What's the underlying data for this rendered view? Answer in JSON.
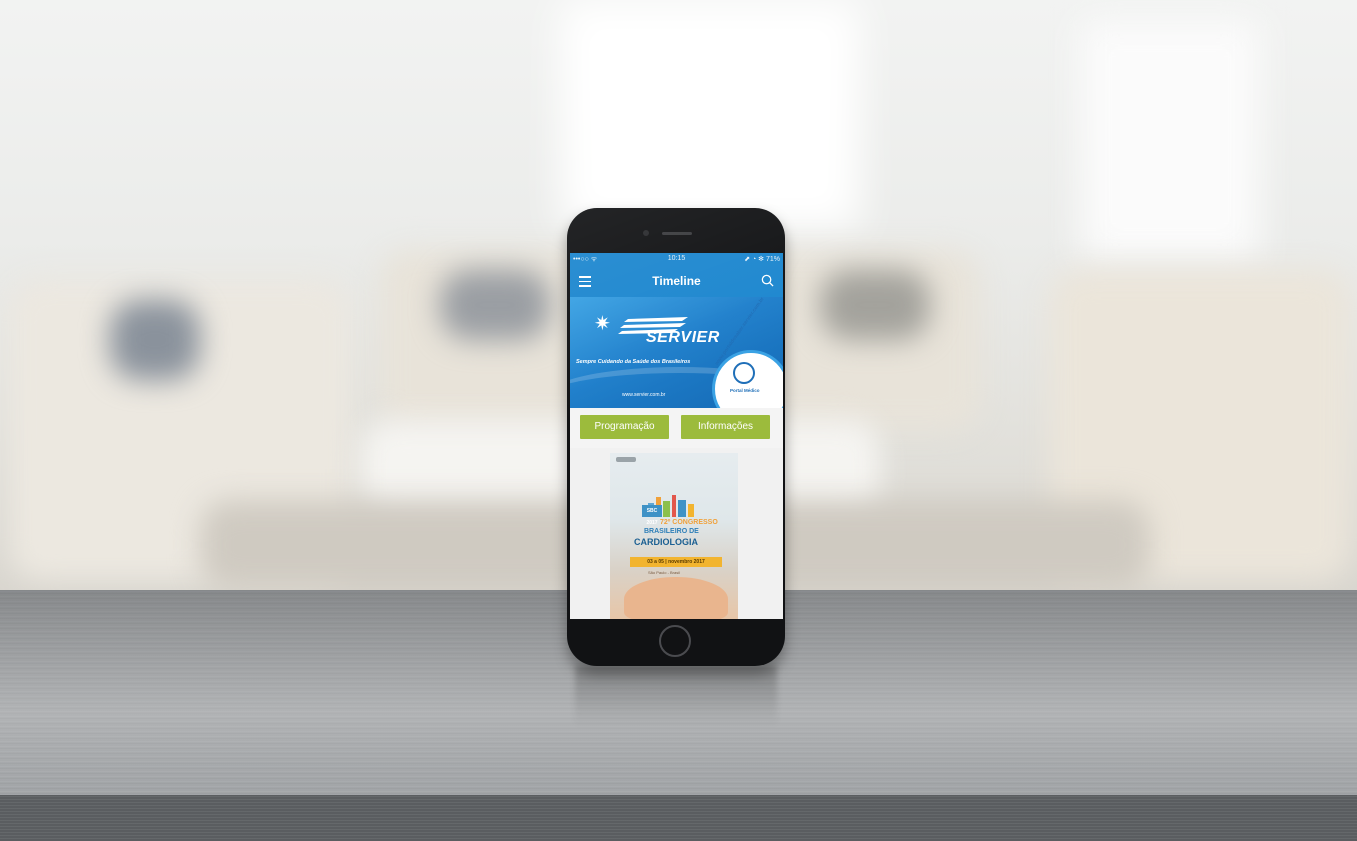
{
  "status_bar": {
    "time": "10:15",
    "signal": "•••○○ ᯤ",
    "right": "⬈ ◔ ✻ 71%"
  },
  "nav": {
    "title": "Timeline",
    "menu_icon": "hamburger-menu-icon",
    "search_icon": "search-icon"
  },
  "banner": {
    "brand": "SERVIER",
    "tagline": "Sempre Cuidando da Saúde dos Brasileiros",
    "url": "www.servier.com.br",
    "badge_url": "www.portaldosaber.servier.com.br",
    "badge_label": "Portal Médico"
  },
  "actions": {
    "programacao": "Programação",
    "informacoes": "Informações"
  },
  "poster": {
    "logo": "SBC 2017",
    "line1": "72º CONGRESSO",
    "line2": "BRASILEIRO DE",
    "line3": "CARDIOLOGIA",
    "date": "03 a 05 | novembro 2017",
    "venue": "São Paulo - Brasil"
  },
  "colors": {
    "nav_blue": "#1d87cf",
    "button_green": "#9cbb3c",
    "phone_body": "#111214"
  }
}
